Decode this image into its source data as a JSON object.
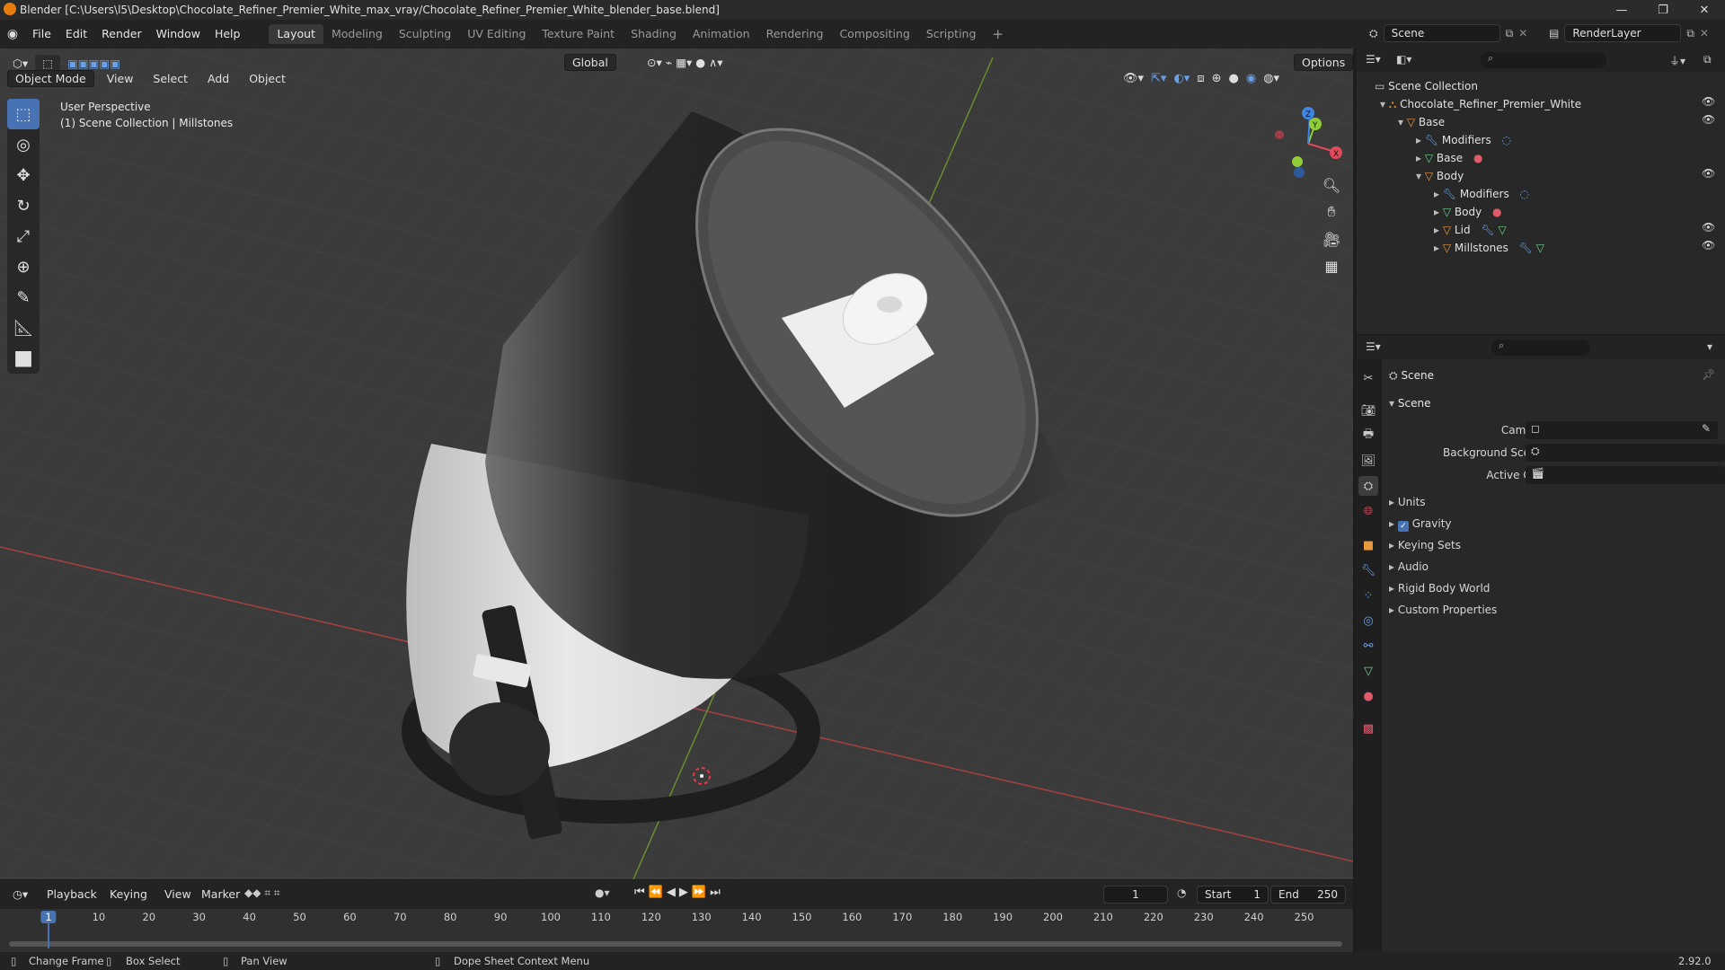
{
  "window": {
    "title": "Blender [C:\\Users\\l5\\Desktop\\Chocolate_Refiner_Premier_White_max_vray/Chocolate_Refiner_Premier_White_blender_base.blend]",
    "minimize": "—",
    "maximize": "❐",
    "close": "✕"
  },
  "menus": [
    "File",
    "Edit",
    "Render",
    "Window",
    "Help"
  ],
  "workspaces": [
    "Layout",
    "Modeling",
    "Sculpting",
    "UV Editing",
    "Texture Paint",
    "Shading",
    "Animation",
    "Rendering",
    "Compositing",
    "Scripting"
  ],
  "workspace_active": "Layout",
  "add_workspace": "+",
  "scene_selector": "Scene",
  "renderlayer_selector": "RenderLayer",
  "viewport": {
    "mode": "Object Mode",
    "menu": [
      "View",
      "Select",
      "Add",
      "Object"
    ],
    "transform_orientation": "Global",
    "options": "Options",
    "perspective": "User Perspective",
    "context": "(1) Scene Collection | Millstones",
    "gizmo": {
      "x": "X",
      "y": "Y",
      "z": "Z"
    }
  },
  "outliner": {
    "root": "Scene Collection",
    "items": [
      {
        "label": "Chocolate_Refiner_Premier_White",
        "icon": "collection-icon"
      },
      {
        "label": "Base",
        "icon": "object-icon"
      },
      {
        "label": "Modifiers",
        "icon": "wrench-icon"
      },
      {
        "label": "Base",
        "icon": "mesh-icon"
      },
      {
        "label": "Body",
        "icon": "object-icon"
      },
      {
        "label": "Modifiers",
        "icon": "wrench-icon"
      },
      {
        "label": "Body",
        "icon": "mesh-icon"
      },
      {
        "label": "Lid",
        "icon": "object-icon"
      },
      {
        "label": "Millstones",
        "icon": "object-icon"
      }
    ]
  },
  "properties": {
    "breadcrumb": "Scene",
    "section": "Scene",
    "fields": [
      {
        "label": "Camera",
        "value": ""
      },
      {
        "label": "Background Scene",
        "value": ""
      },
      {
        "label": "Active Clip",
        "value": ""
      }
    ],
    "panels": [
      "Units",
      "Gravity",
      "Keying Sets",
      "Audio",
      "Rigid Body World",
      "Custom Properties"
    ],
    "gravity_checked": true
  },
  "timeline": {
    "menu": [
      "Playback",
      "Keying",
      "View",
      "Marker"
    ],
    "current_frame": "1",
    "start_label": "Start",
    "start": "1",
    "end_label": "End",
    "end": "250",
    "ticks": [
      "1",
      "10",
      "20",
      "30",
      "40",
      "50",
      "60",
      "70",
      "80",
      "90",
      "100",
      "110",
      "120",
      "130",
      "140",
      "150",
      "160",
      "170",
      "180",
      "190",
      "200",
      "210",
      "220",
      "230",
      "240",
      "250"
    ]
  },
  "statusbar": {
    "change_frame": "Change Frame",
    "box_select": "Box Select",
    "pan_view": "Pan View",
    "context_menu": "Dope Sheet Context Menu",
    "version": "2.92.0"
  },
  "colors": {
    "accent": "#4772b3",
    "x_axis": "#e04b5a",
    "y_axis": "#8fcc38",
    "z_axis": "#3f87e0",
    "object_orange": "#e89a3c",
    "mesh_green": "#6dd08c"
  }
}
